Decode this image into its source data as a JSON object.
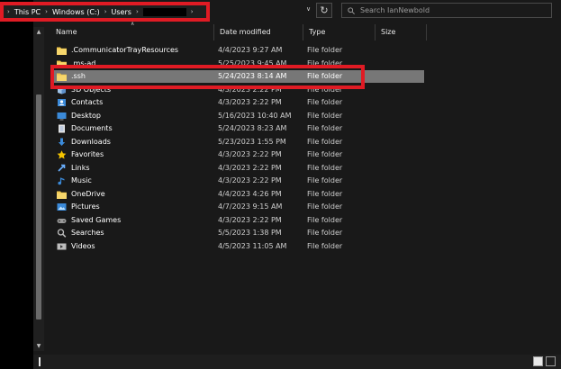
{
  "breadcrumb": {
    "items": [
      "This PC",
      "Windows (C:)",
      "Users"
    ],
    "current_redacted": true
  },
  "search": {
    "placeholder": "Search IanNewbold"
  },
  "columns": {
    "name": "Name",
    "date": "Date modified",
    "type": "Type",
    "size": "Size"
  },
  "files": [
    {
      "name": ".CommunicatorTrayResources",
      "date": "4/4/2023 9:27 AM",
      "type": "File folder",
      "icon": "folder-icon"
    },
    {
      "name": ".ms-ad",
      "date": "5/25/2023 9:45 AM",
      "type": "File folder",
      "icon": "folder-icon"
    },
    {
      "name": ".ssh",
      "date": "5/24/2023 8:14 AM",
      "type": "File folder",
      "icon": "folder-icon",
      "selected": true
    },
    {
      "name": "3D Objects",
      "date": "4/3/2023 2:22 PM",
      "type": "File folder",
      "icon": "cube-icon"
    },
    {
      "name": "Contacts",
      "date": "4/3/2023 2:22 PM",
      "type": "File folder",
      "icon": "contacts-icon"
    },
    {
      "name": "Desktop",
      "date": "5/16/2023 10:40 AM",
      "type": "File folder",
      "icon": "desktop-icon"
    },
    {
      "name": "Documents",
      "date": "5/24/2023 8:23 AM",
      "type": "File folder",
      "icon": "documents-icon"
    },
    {
      "name": "Downloads",
      "date": "5/23/2023 1:55 PM",
      "type": "File folder",
      "icon": "download-icon"
    },
    {
      "name": "Favorites",
      "date": "4/3/2023 2:22 PM",
      "type": "File folder",
      "icon": "star-icon"
    },
    {
      "name": "Links",
      "date": "4/3/2023 2:22 PM",
      "type": "File folder",
      "icon": "link-icon"
    },
    {
      "name": "Music",
      "date": "4/3/2023 2:22 PM",
      "type": "File folder",
      "icon": "music-icon"
    },
    {
      "name": "OneDrive",
      "date": "4/4/2023 4:26 PM",
      "type": "File folder",
      "icon": "folder-icon"
    },
    {
      "name": "Pictures",
      "date": "4/7/2023 9:15 AM",
      "type": "File folder",
      "icon": "pictures-icon"
    },
    {
      "name": "Saved Games",
      "date": "4/3/2023 2:22 PM",
      "type": "File folder",
      "icon": "gamepad-icon"
    },
    {
      "name": "Searches",
      "date": "5/5/2023 1:38 PM",
      "type": "File folder",
      "icon": "search-icon"
    },
    {
      "name": "Videos",
      "date": "4/5/2023 11:05 AM",
      "type": "File folder",
      "icon": "video-icon"
    }
  ],
  "colors": {
    "highlight": "#e01b24",
    "selected_row": "#777777",
    "folder": "#f0c64a"
  }
}
